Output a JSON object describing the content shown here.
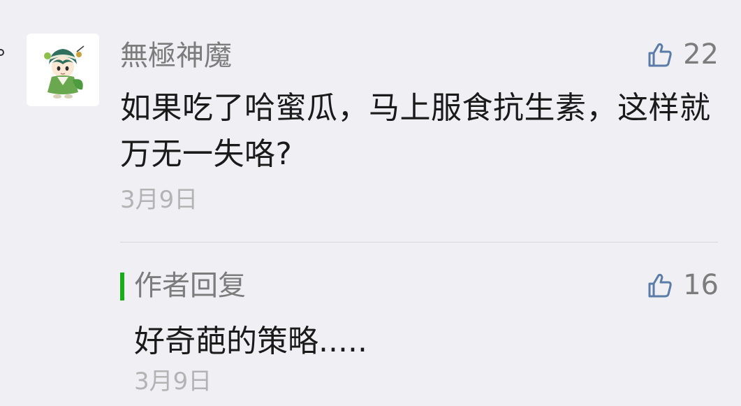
{
  "comment": {
    "author": "無極神魔",
    "avatar_icon": "anime-character-avatar",
    "text": "如果吃了哈蜜瓜，马上服食抗生素，这样就万无一失咯?",
    "date": "3月9日",
    "likes": "22",
    "like_icon": "thumbs-up-icon"
  },
  "reply": {
    "label": "作者回复",
    "text": "好奇葩的策略.....",
    "date": "3月9日",
    "likes": "16",
    "like_icon": "thumbs-up-icon",
    "accent_color": "#1aad19"
  },
  "colors": {
    "background": "#efeff4",
    "primary_text": "#1a1a1a",
    "secondary_text": "#7c7c7c",
    "date_text": "#b3b3b3",
    "like_icon": "#5b7ba8"
  }
}
